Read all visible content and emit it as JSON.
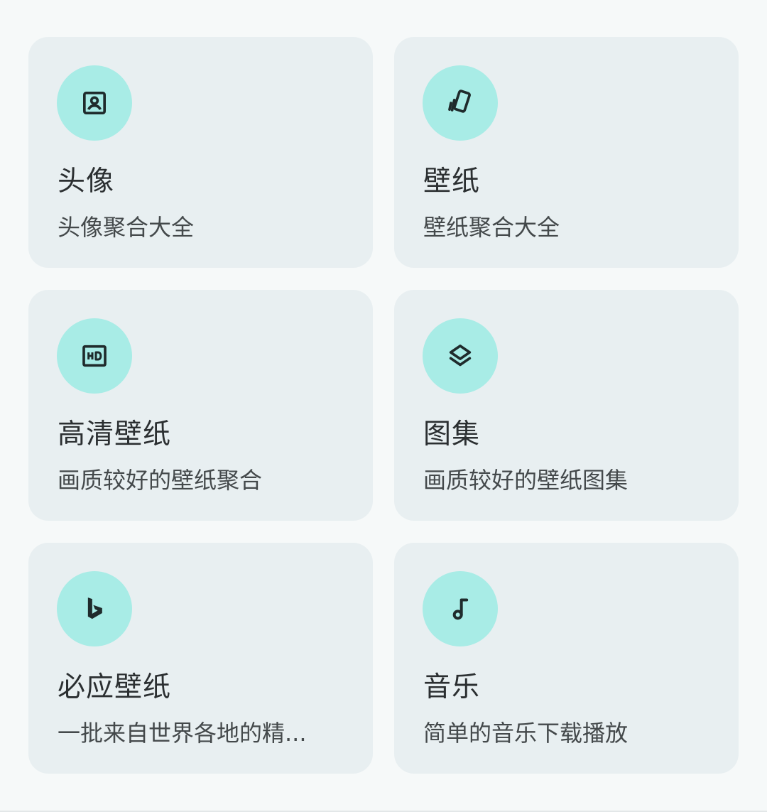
{
  "colors": {
    "background": "#f6f9f9",
    "card": "#e8eff1",
    "icon_circle": "#a8ece6",
    "icon_stroke": "#1f2b2c",
    "title": "#2b2f31",
    "subtitle": "#44494b"
  },
  "cards": [
    {
      "icon": "portrait-icon",
      "title": "头像",
      "subtitle": "头像聚合大全"
    },
    {
      "icon": "wallpaper-cards-icon",
      "title": "壁纸",
      "subtitle": "壁纸聚合大全"
    },
    {
      "icon": "hd-icon",
      "title": "高清壁纸",
      "subtitle": "画质较好的壁纸聚合"
    },
    {
      "icon": "layers-icon",
      "title": "图集",
      "subtitle": "画质较好的壁纸图集"
    },
    {
      "icon": "bing-icon",
      "title": "必应壁纸",
      "subtitle": "一批来自世界各地的精..."
    },
    {
      "icon": "music-note-icon",
      "title": "音乐",
      "subtitle": "简单的音乐下载播放"
    }
  ]
}
